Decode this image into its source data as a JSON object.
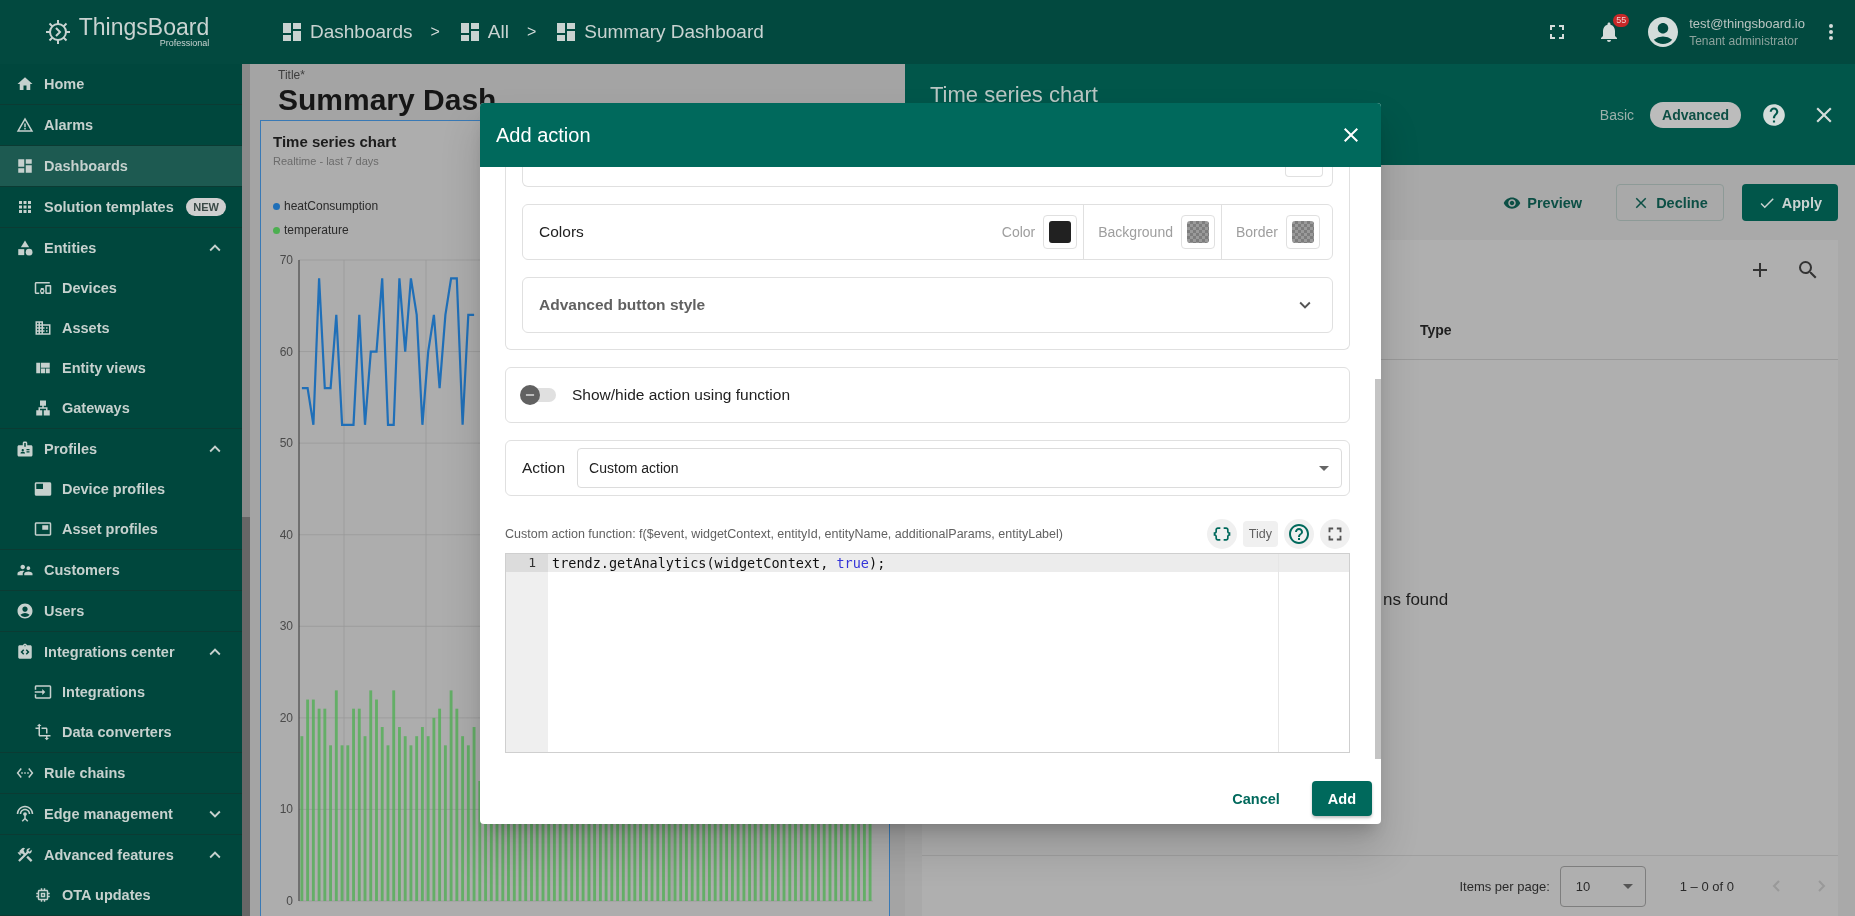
{
  "header": {
    "logo": {
      "name": "ThingsBoard",
      "edition": "Professional"
    },
    "breadcrumbs": [
      {
        "label": "Dashboards"
      },
      {
        "label": "All"
      },
      {
        "label": "Summary Dashboard"
      }
    ],
    "separator": ">",
    "notifications": {
      "count": "55"
    },
    "user": {
      "email": "test@thingsboard.io",
      "role": "Tenant administrator"
    }
  },
  "sidebar": {
    "items": [
      {
        "label": "Home",
        "selected": false
      },
      {
        "label": "Alarms",
        "selected": false
      },
      {
        "label": "Dashboards",
        "selected": true
      },
      {
        "label": "Solution templates",
        "selected": false,
        "badge": "NEW"
      },
      {
        "label": "Entities",
        "selected": false,
        "expanded": true,
        "children": [
          {
            "label": "Devices",
            "selected": false
          },
          {
            "label": "Assets",
            "selected": false
          },
          {
            "label": "Entity views",
            "selected": false
          },
          {
            "label": "Gateways",
            "selected": false
          }
        ]
      },
      {
        "label": "Profiles",
        "selected": false,
        "expanded": true,
        "children": [
          {
            "label": "Device profiles",
            "selected": false
          },
          {
            "label": "Asset profiles",
            "selected": false
          }
        ]
      },
      {
        "label": "Customers",
        "selected": false
      },
      {
        "label": "Users",
        "selected": false
      },
      {
        "label": "Integrations center",
        "selected": false,
        "expanded": true,
        "children": [
          {
            "label": "Integrations",
            "selected": false
          },
          {
            "label": "Data converters",
            "selected": false
          }
        ]
      },
      {
        "label": "Rule chains",
        "selected": false
      },
      {
        "label": "Edge management",
        "selected": false,
        "expanded": false
      },
      {
        "label": "Advanced features",
        "selected": false,
        "expanded": true,
        "children": [
          {
            "label": "OTA updates",
            "selected": false
          }
        ]
      }
    ]
  },
  "dashboard": {
    "title_label": "Title*",
    "title": "Summary Dash",
    "widget": {
      "title": "Time series chart",
      "subtitle": "Realtime - last 7 days",
      "chart_data": {
        "type": "bar",
        "grid": true,
        "categories": [
          null,
          null,
          null,
          null,
          null,
          null,
          null,
          null,
          null,
          null,
          null,
          null,
          null,
          null,
          null,
          null,
          null,
          null,
          null,
          null,
          null,
          null,
          null,
          null,
          null,
          null,
          null,
          null,
          null,
          null,
          null,
          null,
          null,
          null,
          null,
          null,
          null,
          null,
          null,
          null,
          null,
          null,
          null,
          null,
          null,
          null,
          null,
          null,
          null,
          null,
          null,
          null,
          null,
          null,
          null,
          null,
          null,
          null,
          null,
          null,
          null,
          null,
          null,
          null,
          null,
          null,
          null,
          null,
          null,
          null,
          null,
          null,
          null,
          null,
          null,
          null,
          null,
          null,
          null,
          null,
          null,
          null,
          null,
          null,
          null,
          null,
          null,
          null,
          null,
          null,
          null,
          null,
          null,
          null,
          null,
          null,
          null,
          null,
          null,
          null
        ],
        "ylim": [
          0,
          70
        ],
        "yticks": [
          0,
          10,
          20,
          30,
          40,
          50,
          60,
          70
        ],
        "series": [
          {
            "name": "heatConsumption",
            "type": "line",
            "color": "#1f6fb8",
            "values": [
              56,
              56,
              52,
              68,
              56,
              56,
              64,
              52,
              52,
              52,
              64,
              52,
              60,
              60,
              68,
              52,
              52,
              68,
              60,
              68,
              64,
              52,
              60,
              64,
              56,
              64,
              68,
              68,
              52,
              64,
              64,
              null,
              null,
              null,
              null,
              null,
              null,
              null,
              null,
              null,
              null,
              null,
              null,
              null,
              null,
              null,
              null,
              null,
              null,
              null,
              null,
              null,
              null,
              null,
              null,
              null,
              null,
              null,
              null,
              null,
              null,
              null,
              null,
              null,
              null,
              null,
              null,
              null,
              null,
              null,
              null,
              null,
              null,
              null,
              null,
              null,
              null,
              null,
              null,
              null,
              null,
              null,
              null,
              null,
              null,
              null,
              null,
              null,
              null,
              null,
              null,
              null,
              null,
              null,
              null,
              null,
              null,
              null,
              null,
              null
            ]
          },
          {
            "name": "temperature",
            "color": "#4caf50",
            "values": [
              18,
              22,
              22,
              21,
              21,
              17,
              23,
              17,
              17,
              21,
              21,
              18,
              23,
              22,
              19,
              17,
              23,
              19,
              18,
              17,
              18,
              19,
              18,
              20,
              21,
              17,
              23,
              21,
              18,
              17,
              19,
              null,
              null,
              null,
              null,
              null,
              null,
              null,
              null,
              null,
              null,
              null,
              null,
              null,
              null,
              null,
              null,
              null,
              null,
              null,
              null,
              null,
              null,
              null,
              null,
              null,
              null,
              null,
              null,
              null,
              null,
              null,
              null,
              null,
              null,
              null,
              null,
              null,
              null,
              null,
              null,
              null,
              null,
              null,
              null,
              null,
              null,
              null,
              null,
              null,
              null,
              null,
              null,
              null,
              null,
              null,
              null,
              null,
              null,
              null,
              null,
              null,
              null,
              null,
              null,
              null,
              null,
              null,
              null,
              null
            ]
          }
        ]
      }
    }
  },
  "widget_editor": {
    "title": "Time series chart",
    "modes": [
      {
        "label": "Basic",
        "selected": false
      },
      {
        "label": "Advanced",
        "selected": true
      }
    ],
    "actions": [
      {
        "label": "Preview",
        "kind": "text"
      },
      {
        "label": "Decline",
        "kind": "outlined"
      },
      {
        "label": "Apply",
        "kind": "filled"
      }
    ],
    "table": {
      "columns": [
        "Type"
      ],
      "empty_message": "ns found"
    },
    "paginator": {
      "label": "Items per page:",
      "page_size": "10",
      "range": "1 – 0 of 0"
    }
  },
  "dialog": {
    "title": "Add action",
    "colors": {
      "label": "Colors",
      "swatches": [
        {
          "label": "Color",
          "kind": "solid",
          "color": "#212121"
        },
        {
          "label": "Background",
          "kind": "transparent"
        },
        {
          "label": "Border",
          "kind": "transparent"
        }
      ]
    },
    "advanced_style": {
      "label": "Advanced button style",
      "expanded": false
    },
    "show_hide": {
      "label": "Show/hide action using function",
      "on": false
    },
    "action": {
      "label": "Action",
      "value": "Custom action"
    },
    "function": {
      "signature": "Custom action function: f($event, widgetContext, entityId, entityName, additionalParams, entityLabel)",
      "tidy": "Tidy",
      "lines": [
        {
          "number": "1",
          "tokens": [
            {
              "text": "trendz.getAnalytics(widgetContext, ",
              "kind": "plain"
            },
            {
              "text": "true",
              "kind": "keyword"
            },
            {
              "text": ");",
              "kind": "plain"
            }
          ]
        }
      ]
    },
    "buttons": [
      {
        "label": "Cancel",
        "kind": "text"
      },
      {
        "label": "Add",
        "kind": "filled"
      }
    ]
  }
}
